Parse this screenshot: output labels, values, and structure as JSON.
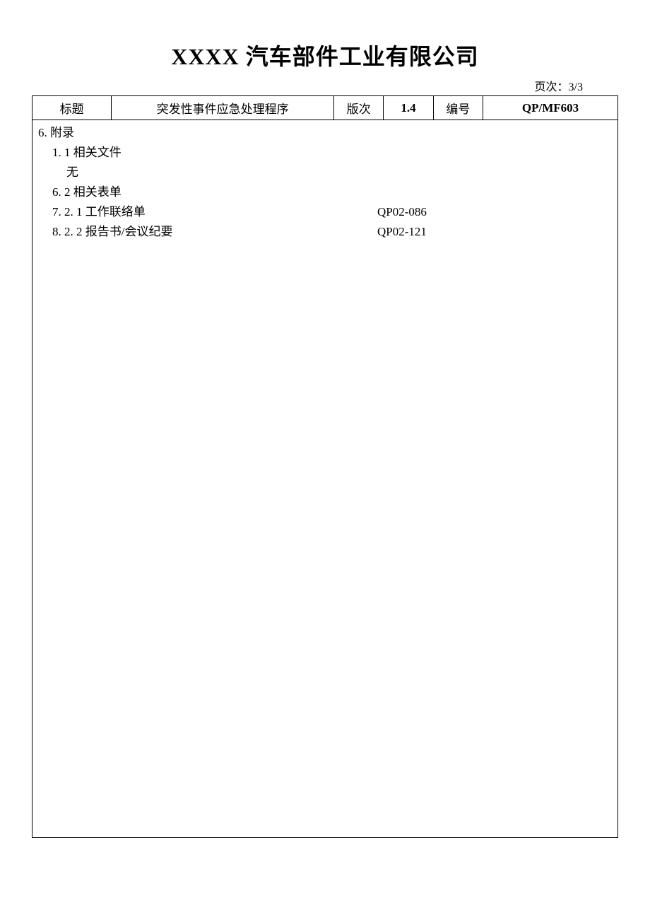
{
  "company": "XXXX 汽车部件工业有限公司",
  "pageLabel": "页次：3/3",
  "header": {
    "titleLabel": "标题",
    "titleValue": "突发性事件应急处理程序",
    "versionLabel": "版次",
    "versionValue": "1.4",
    "numberLabel": "编号",
    "numberValue": "QP/MF603"
  },
  "body": {
    "line1": "6. 附录",
    "line2": "1. 1 相关文件",
    "line3": "无",
    "line4": "6. 2 相关表单",
    "line5left": "7. 2. 1 工作联络单",
    "line5right": "QP02-086",
    "line6left": "8. 2. 2 报告书/会议纪要",
    "line6right": "QP02-121"
  }
}
